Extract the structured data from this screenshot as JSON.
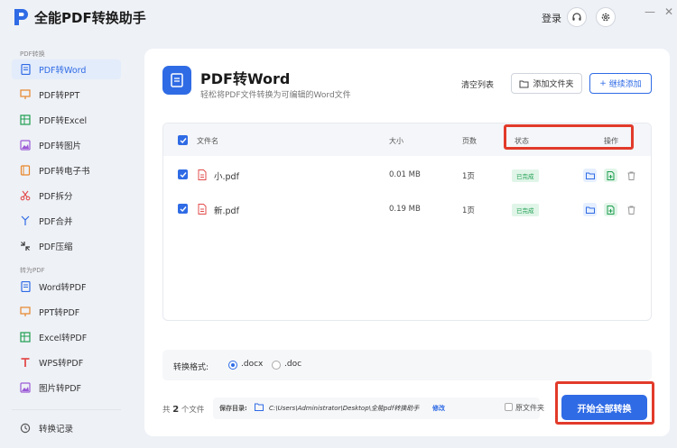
{
  "app": {
    "title": "全能PDF转换助手",
    "login": "登录"
  },
  "sidebar": {
    "section_pdf_convert": "PDF转换",
    "pdf_items": [
      "PDF转Word",
      "PDF转PPT",
      "PDF转Excel",
      "PDF转图片",
      "PDF转电子书",
      "PDF拆分",
      "PDF合并",
      "PDF压缩"
    ],
    "section_to_pdf": "转为PDF",
    "to_pdf_items": [
      "Word转PDF",
      "PPT转PDF",
      "Excel转PDF",
      "WPS转PDF",
      "图片转PDF"
    ],
    "history": "转换记录",
    "active_item": "PDF转Word"
  },
  "header": {
    "title": "PDF转Word",
    "subtitle": "轻松将PDF文件转换为可编辑的Word文件",
    "clear_list": "清空列表",
    "add_folder": "添加文件夹",
    "add_more": "继续添加"
  },
  "table": {
    "columns": {
      "name": "文件名",
      "size": "大小",
      "pages": "页数",
      "status": "状态",
      "actions": "操作"
    },
    "rows": [
      {
        "name": "小.pdf",
        "size": "0.01 MB",
        "pages": "1页",
        "status": "已完成"
      },
      {
        "name": "新.pdf",
        "size": "0.19 MB",
        "pages": "1页",
        "status": "已完成"
      }
    ]
  },
  "format": {
    "label": "转换格式:",
    "options": [
      ".docx",
      ".doc"
    ],
    "selected": ".docx"
  },
  "footer": {
    "count_prefix": "共",
    "count": "2",
    "count_suffix": "个文件",
    "save_label": "保存目录:",
    "save_path": "C:\\Users\\Administrator\\Desktop\\全能pdf转换助手",
    "edit": "修改",
    "original_folder": "原文件夹",
    "start": "开始全部转换"
  },
  "colors": {
    "accent": "#2f6be5",
    "success": "#1e9e50",
    "highlight": "#e23a2a"
  }
}
